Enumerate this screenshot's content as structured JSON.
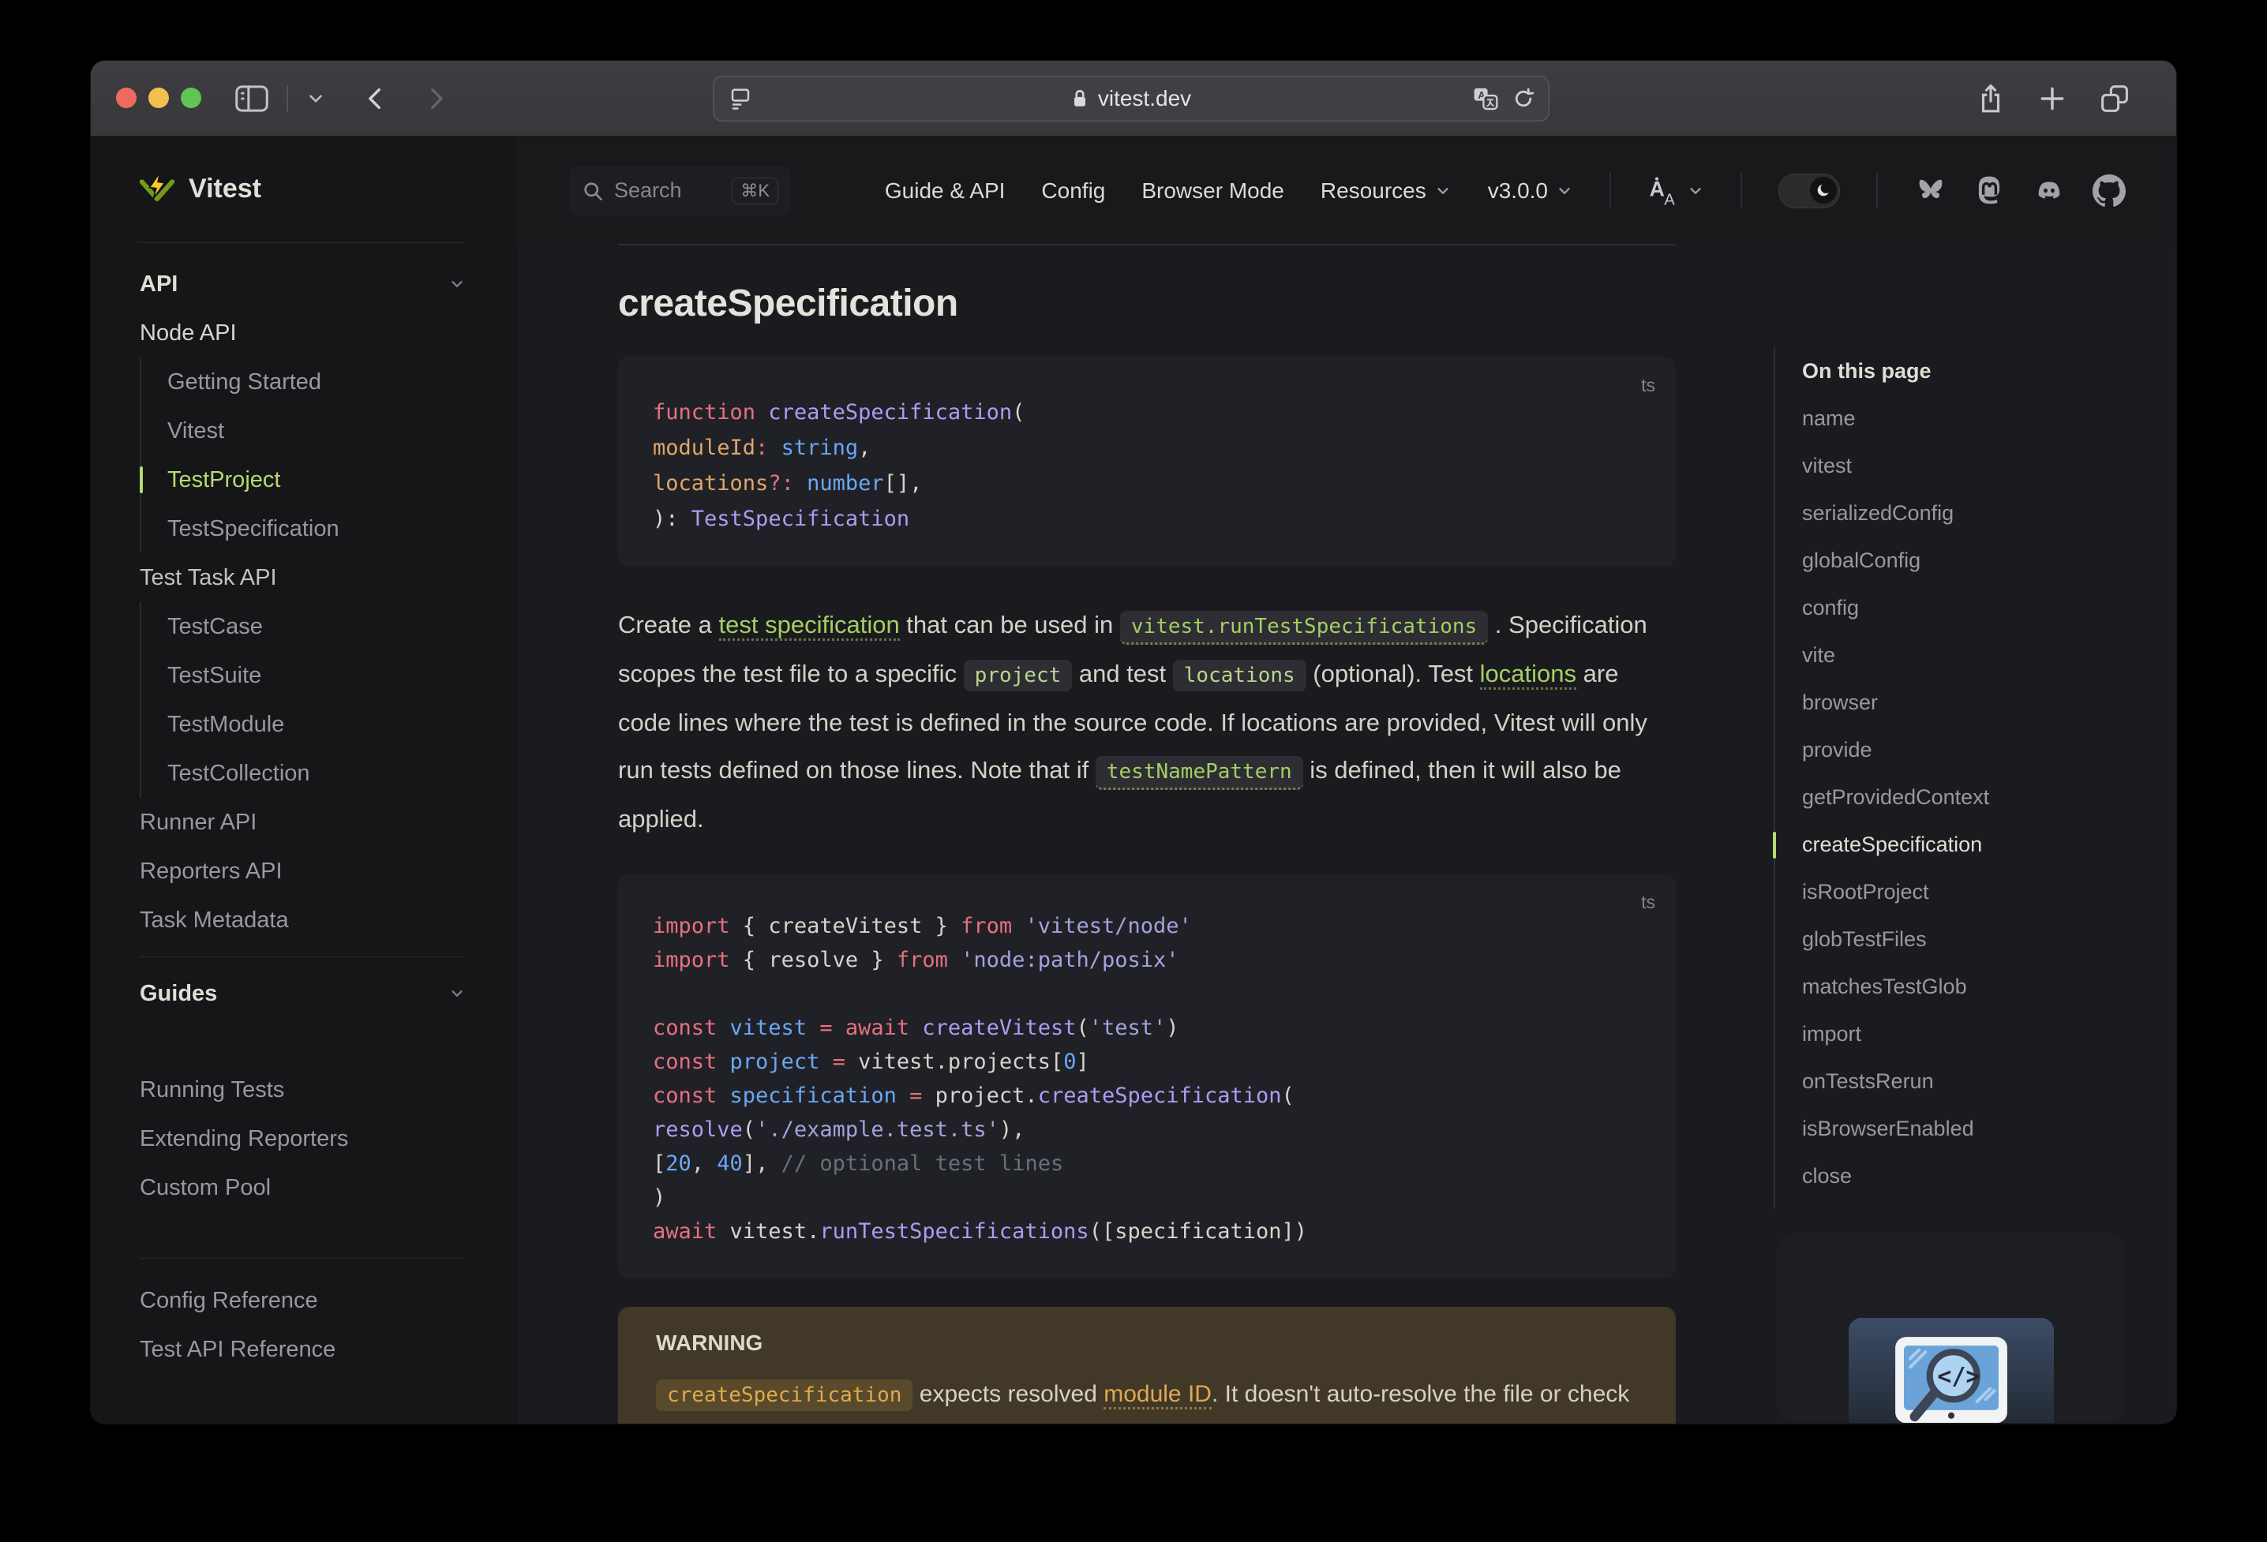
{
  "window": {
    "url": "vitest.dev"
  },
  "navbar": {
    "search_label": "Search",
    "search_kbd": "⌘K",
    "links": [
      {
        "label": "Guide & API",
        "chevron": false
      },
      {
        "label": "Config",
        "chevron": false
      },
      {
        "label": "Browser Mode",
        "chevron": false
      },
      {
        "label": "Resources",
        "chevron": true
      },
      {
        "label": "v3.0.0",
        "chevron": true
      }
    ]
  },
  "sidebar": {
    "logo_text": "Vitest",
    "groups": [
      {
        "title": "API",
        "chevron": true,
        "items": [
          {
            "label": "Node API",
            "level": 0,
            "tone": "strong"
          },
          {
            "label": "Getting Started",
            "level": 1
          },
          {
            "label": "Vitest",
            "level": 1
          },
          {
            "label": "TestProject",
            "level": 1,
            "active": true
          },
          {
            "label": "TestSpecification",
            "level": 1
          },
          {
            "label": "Test Task API",
            "level": 0,
            "tone": "semi"
          },
          {
            "label": "TestCase",
            "level": 1
          },
          {
            "label": "TestSuite",
            "level": 1
          },
          {
            "label": "TestModule",
            "level": 1
          },
          {
            "label": "TestCollection",
            "level": 1
          },
          {
            "label": "Runner API",
            "level": 0
          },
          {
            "label": "Reporters API",
            "level": 0
          },
          {
            "label": "Task Metadata",
            "level": 0
          }
        ]
      },
      {
        "title": "Guides",
        "chevron": true,
        "divider_before": "normal",
        "gap_items": true,
        "items": [
          {
            "label": "Running Tests",
            "level": 0
          },
          {
            "label": "Extending Reporters",
            "level": 0
          },
          {
            "label": "Custom Pool",
            "level": 0
          }
        ]
      },
      {
        "title": null,
        "divider_before": "big",
        "items": [
          {
            "label": "Config Reference",
            "level": 0
          },
          {
            "label": "Test API Reference",
            "level": 0
          }
        ]
      }
    ]
  },
  "doc": {
    "title": "createSpecification",
    "code1": {
      "lang": "ts",
      "lines": [
        [
          [
            "kw",
            "function"
          ],
          [
            "pl",
            " "
          ],
          [
            "fn",
            "createSpecification"
          ],
          [
            "pl",
            "("
          ]
        ],
        [
          [
            "pl",
            "  "
          ],
          [
            "prop",
            "moduleId"
          ],
          [
            "op",
            ": "
          ],
          [
            "type",
            "string"
          ],
          [
            "pl",
            ","
          ]
        ],
        [
          [
            "pl",
            "  "
          ],
          [
            "prop",
            "locations"
          ],
          [
            "op",
            "?: "
          ],
          [
            "type",
            "number"
          ],
          [
            "pl",
            "[],"
          ]
        ],
        [
          [
            "pl",
            "): "
          ],
          [
            "fn",
            "TestSpecification"
          ]
        ]
      ]
    },
    "paragraph": [
      [
        "t",
        "Create a "
      ],
      [
        "link",
        "test specification"
      ],
      [
        "t",
        " that can be used in "
      ],
      [
        "codelink",
        "vitest.runTestSpecifications"
      ],
      [
        "t",
        " . Specification scopes the test file to a specific "
      ],
      [
        "code",
        "project"
      ],
      [
        "t",
        " and test "
      ],
      [
        "code",
        "locations"
      ],
      [
        "t",
        " (optional). Test "
      ],
      [
        "link",
        "locations"
      ],
      [
        "t",
        " are code lines where the test is defined in the source code. If locations are provided, Vitest will only run tests defined on those lines. Note that if "
      ],
      [
        "codelink",
        "testNamePattern"
      ],
      [
        "t",
        " is defined, then it will also be applied."
      ]
    ],
    "code2": {
      "lang": "ts",
      "lines": [
        [
          [
            "kw",
            "import"
          ],
          [
            "pl",
            " { createVitest } "
          ],
          [
            "kw",
            "from"
          ],
          [
            "str",
            " 'vitest/node'"
          ]
        ],
        [
          [
            "kw",
            "import"
          ],
          [
            "pl",
            " { resolve } "
          ],
          [
            "kw",
            "from"
          ],
          [
            "str",
            " 'node:path/posix'"
          ]
        ],
        [],
        [
          [
            "kw",
            "const"
          ],
          [
            "var",
            " vitest"
          ],
          [
            "op",
            " = "
          ],
          [
            "kw",
            "await"
          ],
          [
            "fn",
            " createVitest"
          ],
          [
            "pl",
            "("
          ],
          [
            "str",
            "'test'"
          ],
          [
            "pl",
            ")"
          ]
        ],
        [
          [
            "kw",
            "const"
          ],
          [
            "var",
            " project"
          ],
          [
            "op",
            " = "
          ],
          [
            "pl",
            "vitest.projects["
          ],
          [
            "num",
            "0"
          ],
          [
            "pl",
            "]"
          ]
        ],
        [
          [
            "kw",
            "const"
          ],
          [
            "var",
            " specification"
          ],
          [
            "op",
            " = "
          ],
          [
            "pl",
            "project."
          ],
          [
            "fn",
            "createSpecification"
          ],
          [
            "pl",
            "("
          ]
        ],
        [
          [
            "pl",
            "  "
          ],
          [
            "fn",
            "resolve"
          ],
          [
            "pl",
            "("
          ],
          [
            "str",
            "'./example.test.ts'"
          ],
          [
            "pl",
            "),"
          ]
        ],
        [
          [
            "pl",
            "  ["
          ],
          [
            "num",
            "20"
          ],
          [
            "pl",
            ", "
          ],
          [
            "num",
            "40"
          ],
          [
            "pl",
            "], "
          ],
          [
            "cmt",
            "// optional test lines"
          ]
        ],
        [
          [
            "pl",
            ")"
          ]
        ],
        [
          [
            "kw",
            "await"
          ],
          [
            "pl",
            " vitest."
          ],
          [
            "fn",
            "runTestSpecifications"
          ],
          [
            "pl",
            "(["
          ],
          [
            "pl",
            "specification"
          ],
          [
            "pl",
            "])"
          ]
        ]
      ]
    },
    "warning": {
      "label": "WARNING",
      "segments": [
        [
          "code",
          "createSpecification"
        ],
        [
          "t",
          " expects resolved "
        ],
        [
          "linkorange",
          "module ID"
        ],
        [
          "t",
          ". It doesn't auto-resolve the file or check that it exists on the file system."
        ]
      ]
    }
  },
  "aside": {
    "title": "On this page",
    "items": [
      "name",
      "vitest",
      "serializedConfig",
      "globalConfig",
      "config",
      "vite",
      "browser",
      "provide",
      "getProvidedContext",
      {
        "label": "createSpecification",
        "active": true
      },
      "isRootProject",
      "globTestFiles",
      "matchesTestGlob",
      "import",
      "onTestsRerun",
      "isBrowserEnabled",
      "close"
    ]
  },
  "icons": {
    "titlebar": [
      "close",
      "minimize",
      "zoom",
      "sidebar-toggle",
      "chevron-down",
      "back",
      "forward",
      "share",
      "new-tab",
      "tab-overview"
    ],
    "urlbar": [
      "page",
      "lock",
      "translate",
      "reload"
    ],
    "navbar": [
      "search",
      "language",
      "theme-toggle-moon",
      "bluesky",
      "mastodon",
      "discord",
      "github"
    ],
    "aside_card": "code-search-monitor-illustration"
  },
  "colors": {
    "brand_green": "#b6da6e",
    "link_green": "#a5cf63",
    "warning_bg": "#413827",
    "warning_orange": "#dfa94f",
    "code_bg": "#202127",
    "token_red": "#e8707e",
    "token_purple": "#ab9df2",
    "token_blue": "#6aa7f5",
    "token_orange": "#dfa66b",
    "token_string": "#a7a1dd",
    "token_comment": "#6a6f78"
  }
}
